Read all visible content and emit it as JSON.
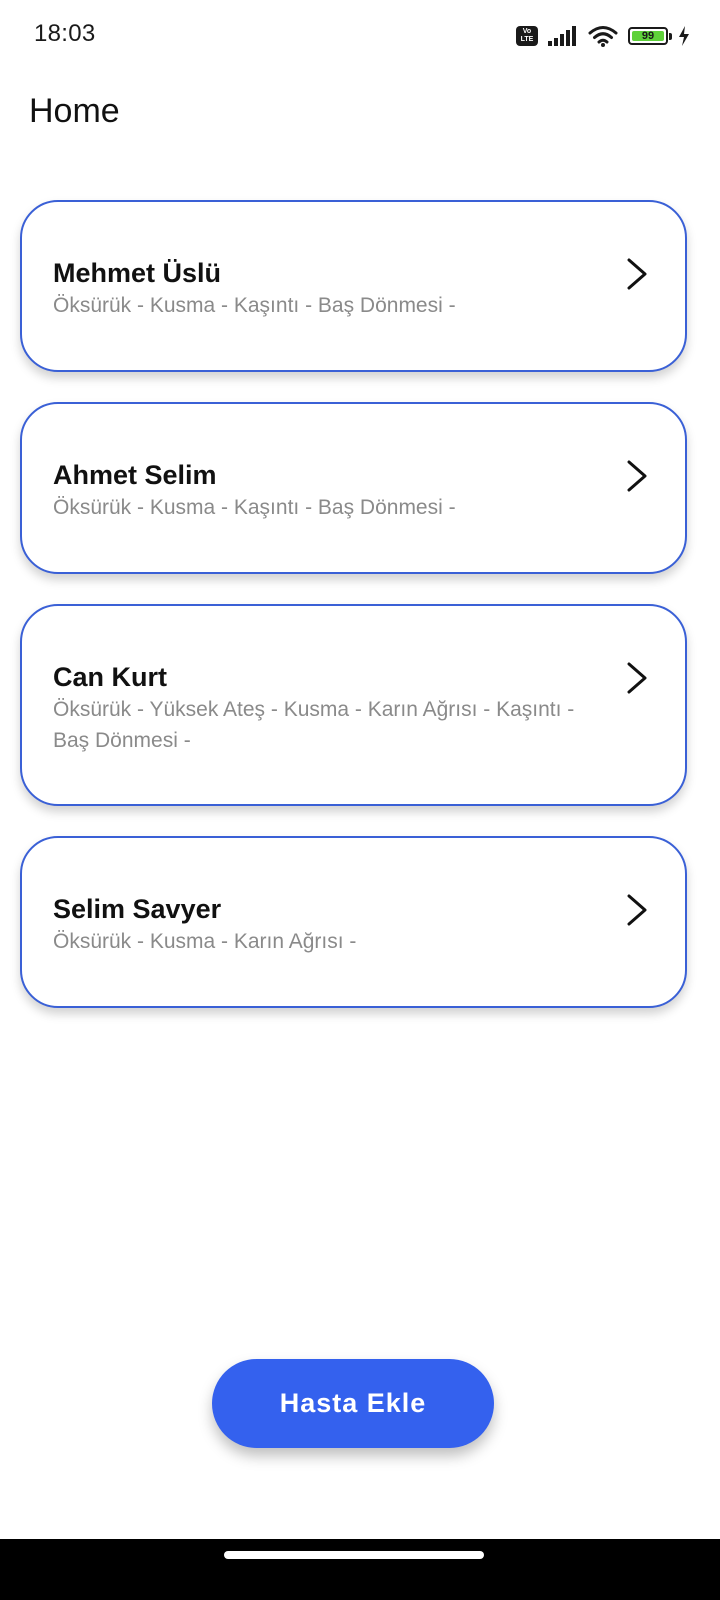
{
  "status_bar": {
    "time": "18:03",
    "volte_top": "Vo",
    "volte_bottom": "LTE",
    "battery": "99",
    "battery_level_percent": 99
  },
  "header": {
    "title": "Home"
  },
  "patients": [
    {
      "name": "Mehmet Üslü",
      "symptoms": "Öksürük - Kusma - Kaşıntı - Baş Dönmesi -"
    },
    {
      "name": "Ahmet Selim",
      "symptoms": "Öksürük - Kusma - Kaşıntı - Baş Dönmesi -"
    },
    {
      "name": "Can Kurt",
      "symptoms": "Öksürük - Yüksek Ateş - Kusma - Karın Ağrısı - Kaşıntı - Baş Dönmesi -"
    },
    {
      "name": "Selim Savyer",
      "symptoms": "Öksürük - Kusma - Karın Ağrısı -"
    }
  ],
  "actions": {
    "add_patient_label": "Hasta Ekle"
  },
  "colors": {
    "accent": "#3461ee",
    "card_border": "#3a60d6",
    "secondary_text": "#8a8a8a",
    "battery": "#5fd13a"
  },
  "icons": {
    "chevron": "chevron-right-icon",
    "signal": "signal-icon",
    "wifi": "wifi-icon",
    "battery": "battery-icon",
    "charging": "charging-icon",
    "volte": "volte-icon"
  }
}
